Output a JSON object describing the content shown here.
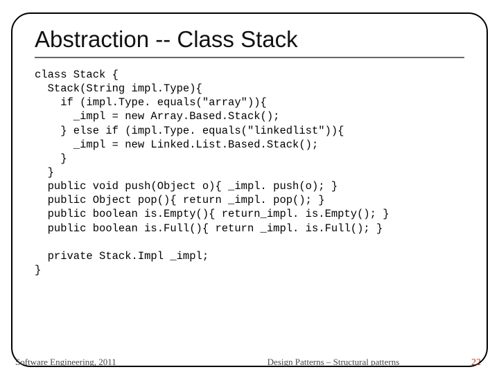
{
  "title": "Abstraction -- Class Stack",
  "code": "class Stack {\n  Stack(String impl.Type){\n    if (impl.Type. equals(\"array\")){\n      _impl = new Array.Based.Stack();\n    } else if (impl.Type. equals(\"linkedlist\")){\n      _impl = new Linked.List.Based.Stack();\n    }\n  }\n  public void push(Object o){ _impl. push(o); }\n  public Object pop(){ return _impl. pop(); }\n  public boolean is.Empty(){ return_impl. is.Empty(); }\n  public boolean is.Full(){ return _impl. is.Full(); }\n\n  private Stack.Impl _impl;\n}",
  "footer": {
    "left": "Software Engineering, 2011",
    "center": "Design Patterns – Structural patterns",
    "page": "22"
  }
}
